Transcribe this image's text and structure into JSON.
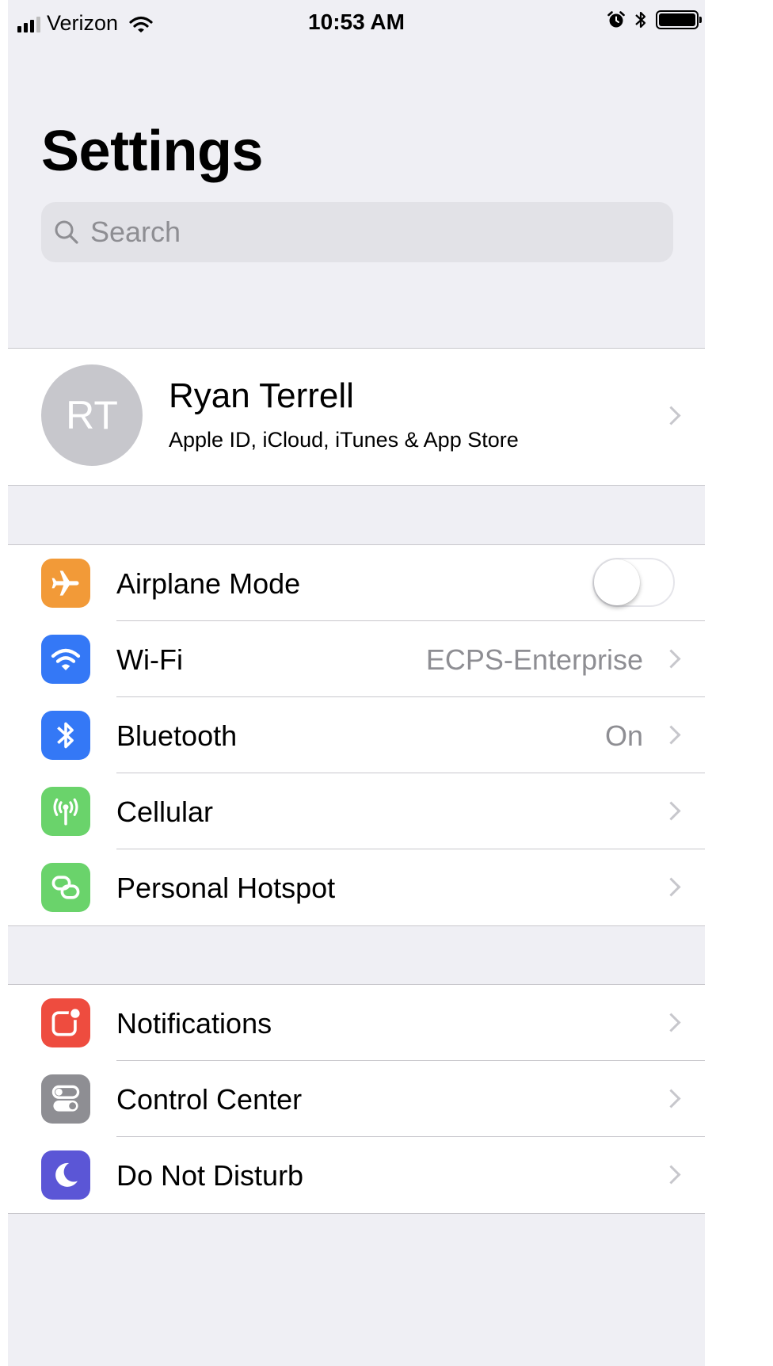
{
  "status_bar": {
    "carrier": "Verizon",
    "time": "10:53 AM"
  },
  "page_title": "Settings",
  "search": {
    "placeholder": "Search"
  },
  "profile": {
    "initials": "RT",
    "name": "Ryan Terrell",
    "subtitle": "Apple ID, iCloud, iTunes & App Store"
  },
  "group1": [
    {
      "label": "Airplane Mode",
      "icon": "airplane-icon",
      "color": "#f29a38",
      "toggle_on": false
    },
    {
      "label": "Wi-Fi",
      "icon": "wifi-icon",
      "color": "#3478f6",
      "value": "ECPS-Enterprise"
    },
    {
      "label": "Bluetooth",
      "icon": "bluetooth-icon",
      "color": "#3478f6",
      "value": "On"
    },
    {
      "label": "Cellular",
      "icon": "antenna-icon",
      "color": "#6ad36b"
    },
    {
      "label": "Personal Hotspot",
      "icon": "hotspot-icon",
      "color": "#6ad36b"
    }
  ],
  "group2": [
    {
      "label": "Notifications",
      "icon": "notifications-icon",
      "color": "#ee4c3f"
    },
    {
      "label": "Control Center",
      "icon": "control-center-icon",
      "color": "#8e8e93"
    },
    {
      "label": "Do Not Disturb",
      "icon": "moon-icon",
      "color": "#5b56d6"
    }
  ]
}
